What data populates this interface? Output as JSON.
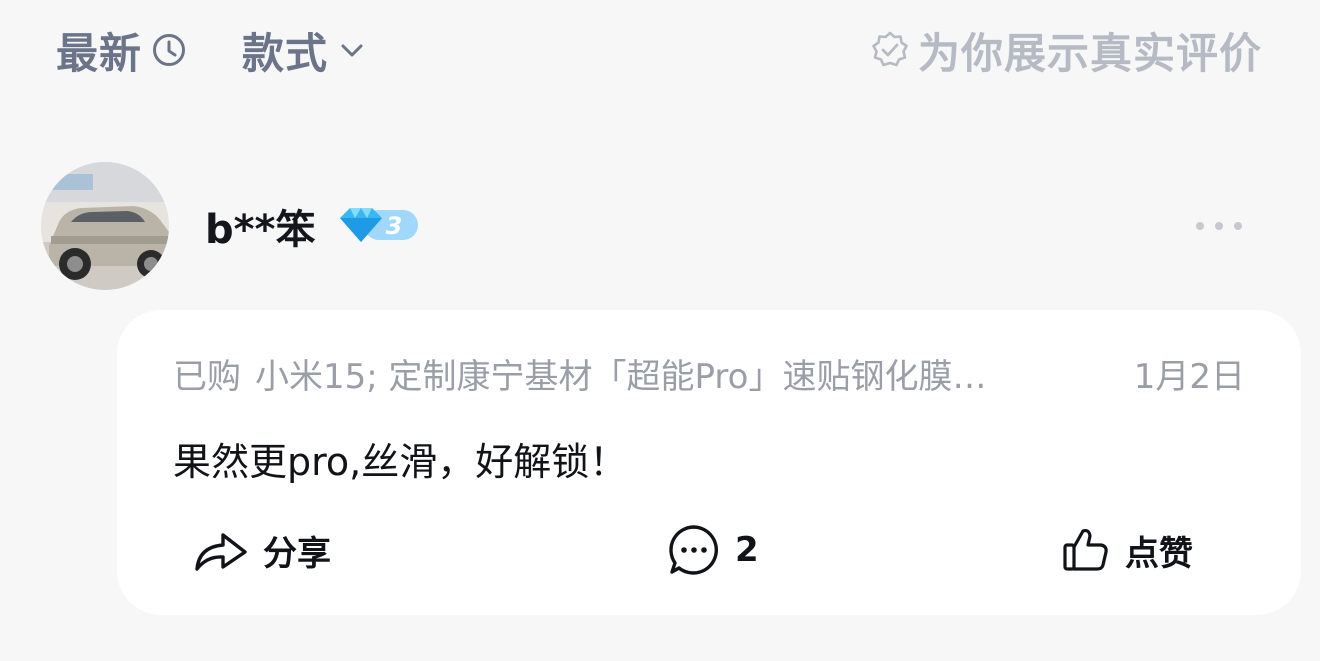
{
  "filter_bar": {
    "sort_label": "最新",
    "sort_icon": "clock-icon",
    "style_label": "款式",
    "style_icon": "chevron-down-icon",
    "verified_label": "为你展示真实评价",
    "verified_icon": "verified-badge-icon"
  },
  "review": {
    "user": {
      "name": "b**笨",
      "level": "3",
      "level_icon": "diamond-icon",
      "avatar_icon": "car-photo-avatar"
    },
    "more_icon": "more-dots-icon",
    "purchase": {
      "label": "已购",
      "product": "小米15; 定制康宁基材「超能Pro」速贴钢化膜…",
      "date": "1月2日"
    },
    "text": "果然更pro,丝滑，好解锁！",
    "actions": {
      "share_label": "分享",
      "share_icon": "share-arrow-icon",
      "comment_count": "2",
      "comment_icon": "comment-bubble-icon",
      "like_label": "点赞",
      "like_icon": "thumbs-up-icon"
    }
  },
  "colors": {
    "background": "#f7f7f8",
    "card": "#ffffff",
    "filter_text": "#6b7488",
    "verified_text": "#b5bac4",
    "muted_text": "#9a9ea7",
    "primary_text": "#111318",
    "badge_blue": "#3aa8f0"
  }
}
